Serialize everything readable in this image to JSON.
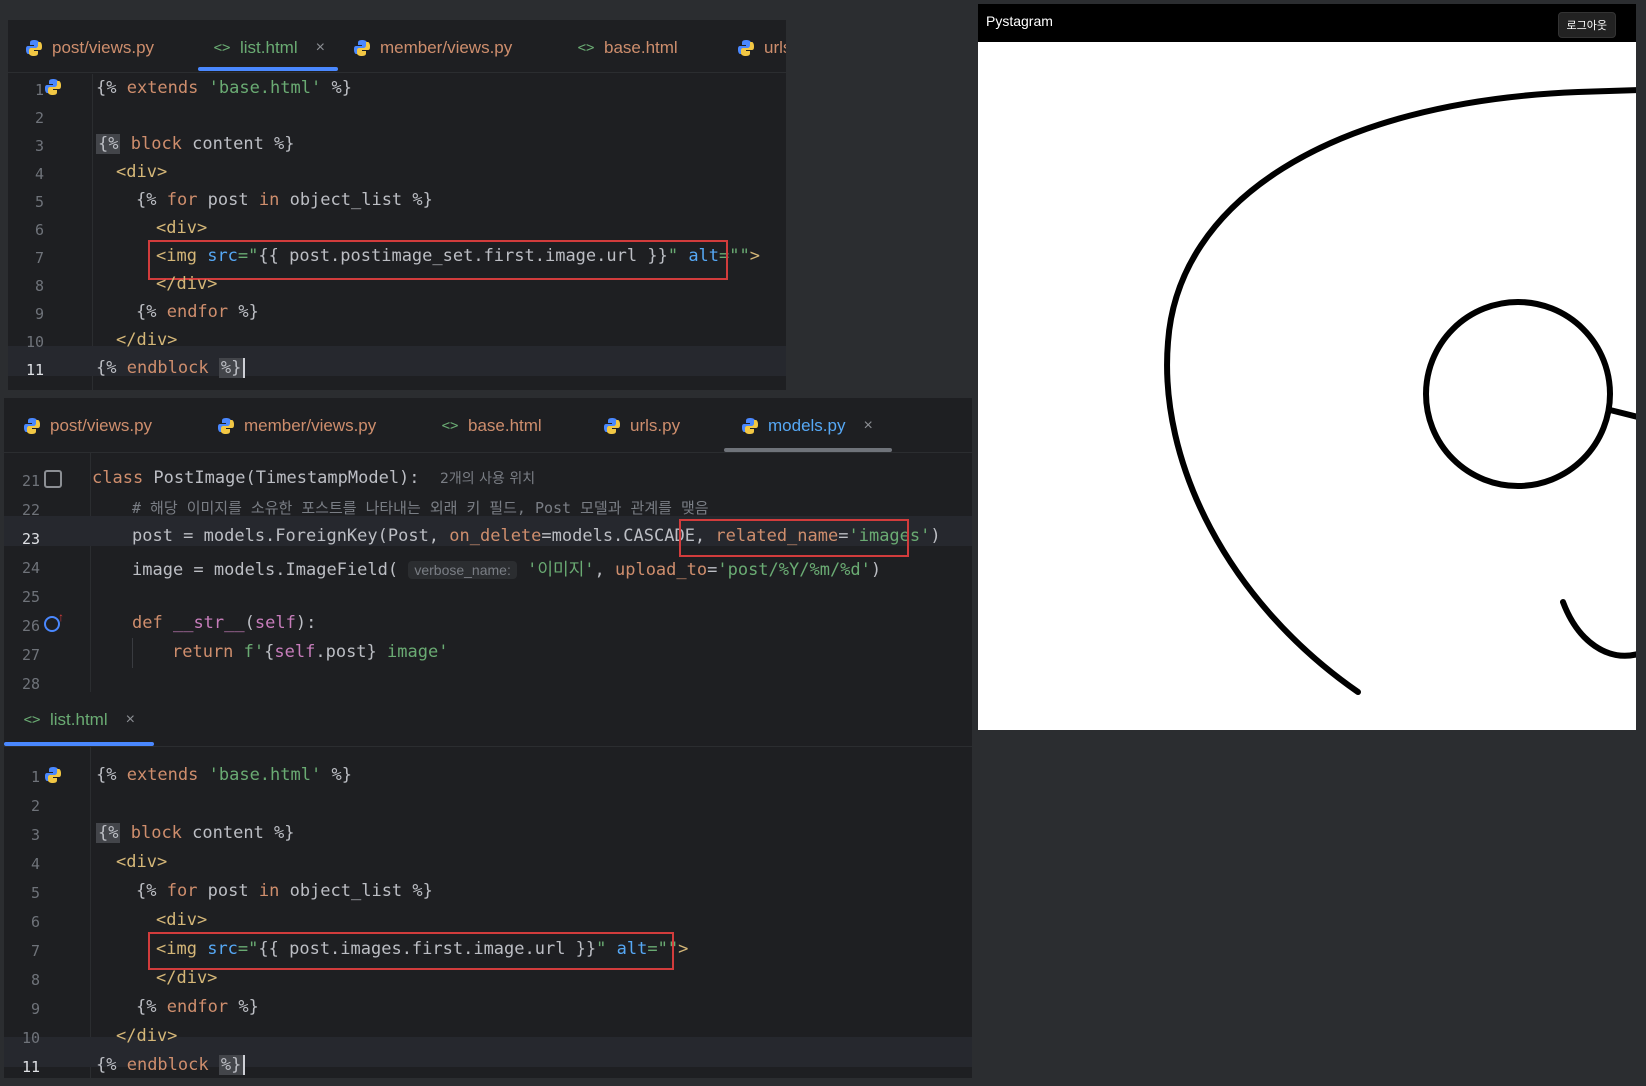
{
  "panel1": {
    "tabs": [
      {
        "label": "post/views.py",
        "icon": "python-icon",
        "active": false
      },
      {
        "label": "list.html",
        "icon": "html-icon",
        "active": true,
        "close": "×"
      },
      {
        "label": "member/views.py",
        "icon": "python-icon",
        "active": false
      },
      {
        "label": "base.html",
        "icon": "html-icon",
        "active": false
      },
      {
        "label": "urls",
        "icon": "python-icon",
        "active": false
      }
    ],
    "line_numbers": [
      "1",
      "2",
      "3",
      "4",
      "5",
      "6",
      "7",
      "8",
      "9",
      "10",
      "11"
    ]
  },
  "panel2": {
    "tabs": [
      {
        "label": "post/views.py",
        "icon": "python-icon",
        "active": false
      },
      {
        "label": "member/views.py",
        "icon": "python-icon",
        "active": false
      },
      {
        "label": "base.html",
        "icon": "html-icon",
        "active": false
      },
      {
        "label": "urls.py",
        "icon": "python-icon",
        "active": false
      },
      {
        "label": "models.py",
        "icon": "python-icon",
        "active": true,
        "close": "×"
      }
    ],
    "line_numbers": [
      "21",
      "22",
      "23",
      "24",
      "25",
      "26",
      "27",
      "28"
    ],
    "usage_hint": "2개의 사용 위치",
    "comment": "# 해당 이미지를 소유한 포스트를 나타내는 외래 키 필드, Post 모델과 관계를 맺음",
    "verbose_hint": "verbose_name:"
  },
  "panel3": {
    "tabs": [
      {
        "label": "list.html",
        "icon": "html-icon",
        "active": true,
        "close": "×"
      }
    ],
    "line_numbers": [
      "1",
      "2",
      "3",
      "4",
      "5",
      "6",
      "7",
      "8",
      "9",
      "10",
      "11"
    ]
  },
  "browser": {
    "title": "Pystagram",
    "logout_label": "로그아웃"
  },
  "colors": {
    "tab_underline": "#4a88ff",
    "highlight_box": "#d23c3c"
  }
}
